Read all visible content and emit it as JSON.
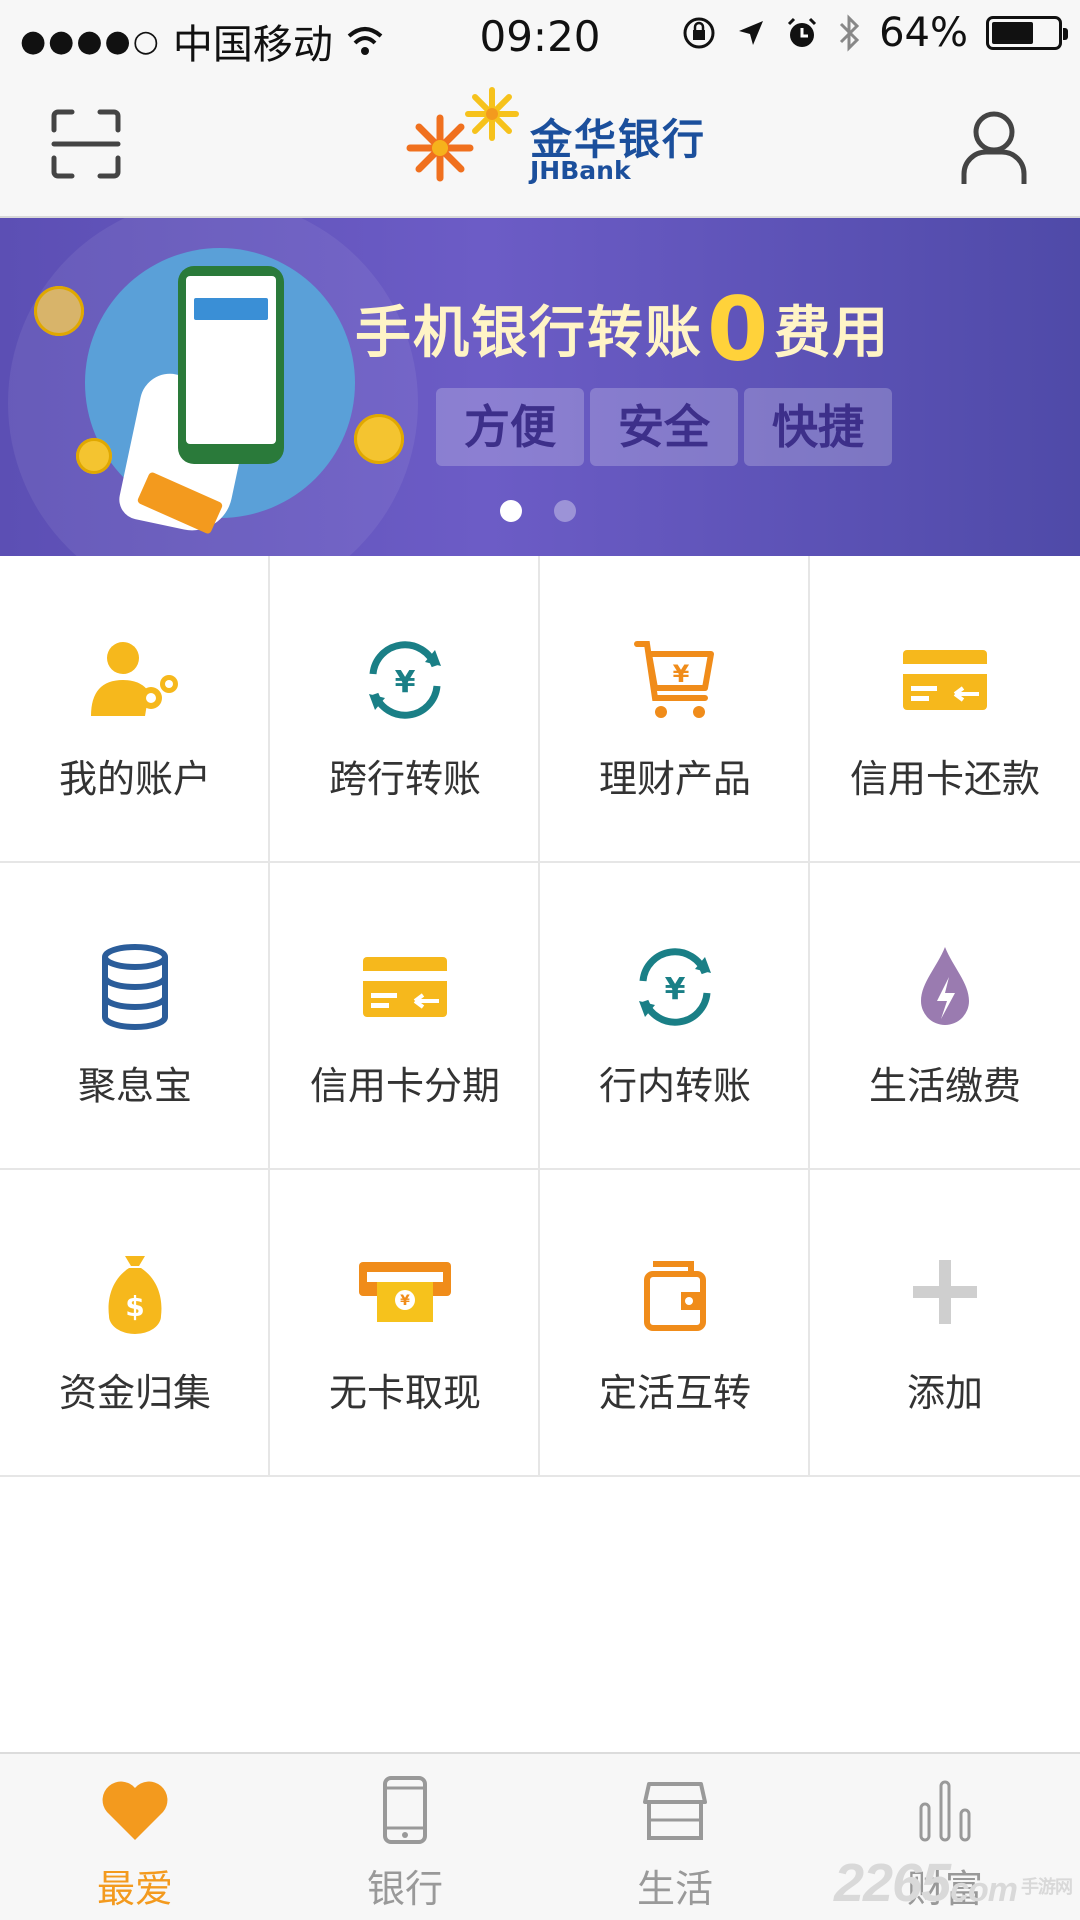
{
  "status_bar": {
    "signal": "●●●●○",
    "carrier": "中国移动",
    "time": "09:20",
    "battery_text": "64%",
    "battery_level": 0.64
  },
  "header": {
    "logo_cn": "金华银行",
    "logo_en": "JHBank",
    "scan_icon": "scan-icon",
    "profile_icon": "user-icon"
  },
  "banner": {
    "title_before": "手机银行转账",
    "title_zero": "0",
    "title_after": "费用",
    "tags": [
      "方便",
      "安全",
      "快捷"
    ],
    "page_count": 2,
    "active_page": 1
  },
  "grid": [
    {
      "label": "我的账户",
      "icon": "account-icon"
    },
    {
      "label": "跨行转账",
      "icon": "transfer-icon"
    },
    {
      "label": "理财产品",
      "icon": "cart-icon"
    },
    {
      "label": "信用卡还款",
      "icon": "credit-card-icon"
    },
    {
      "label": "聚息宝",
      "icon": "database-icon"
    },
    {
      "label": "信用卡分期",
      "icon": "credit-card-icon"
    },
    {
      "label": "行内转账",
      "icon": "transfer-icon"
    },
    {
      "label": "生活缴费",
      "icon": "utility-drop-icon"
    },
    {
      "label": "资金归集",
      "icon": "money-bag-icon"
    },
    {
      "label": "无卡取现",
      "icon": "atm-cash-icon"
    },
    {
      "label": "定活互转",
      "icon": "wallet-icon"
    },
    {
      "label": "添加",
      "icon": "plus-icon"
    }
  ],
  "tabs": [
    {
      "label": "最爱",
      "icon": "heart-icon",
      "active": true
    },
    {
      "label": "银行",
      "icon": "phone-icon",
      "active": false
    },
    {
      "label": "生活",
      "icon": "shop-icon",
      "active": false
    },
    {
      "label": "财富",
      "icon": "bar-chart-icon",
      "active": false
    }
  ],
  "watermark": {
    "text": "2265",
    "suffix": "com",
    "sub": "手游网"
  },
  "colors": {
    "brand_blue": "#1b4f9c",
    "accent_orange": "#f39a1e",
    "banner_purple": "#5c4fb4",
    "teal": "#1a8a8a"
  }
}
